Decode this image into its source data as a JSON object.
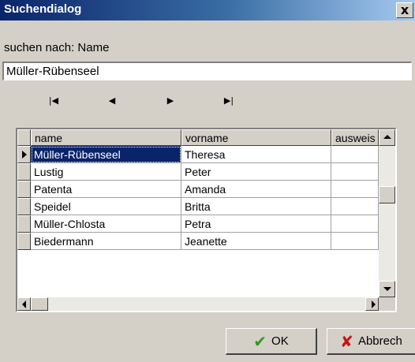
{
  "window": {
    "title": "Suchendialog",
    "close_label": "x"
  },
  "search": {
    "label": "suchen nach: Name",
    "value": "Müller-Rübenseel"
  },
  "navigator": {
    "first_glyph": "|◀",
    "prior_glyph": "◀",
    "next_glyph": "▶",
    "last_glyph": "▶|"
  },
  "grid": {
    "columns": [
      "name",
      "vorname",
      "ausweis"
    ],
    "rows": [
      {
        "name": "Müller-Rübenseel",
        "vorname": "Theresa",
        "ausweis": ""
      },
      {
        "name": "Lustig",
        "vorname": "Peter",
        "ausweis": ""
      },
      {
        "name": "Patenta",
        "vorname": "Amanda",
        "ausweis": ""
      },
      {
        "name": "Speidel",
        "vorname": "Britta",
        "ausweis": ""
      },
      {
        "name": "Müller-Chlosta",
        "vorname": "Petra",
        "ausweis": ""
      },
      {
        "name": "Biedermann",
        "vorname": "Jeanette",
        "ausweis": ""
      }
    ],
    "selected_row": 0
  },
  "buttons": {
    "ok_label": "OK",
    "ok_icon": "✔",
    "ok_icon_color": "#2e9a1e",
    "cancel_label": "Abbrech",
    "cancel_icon": "✘",
    "cancel_icon_color": "#c81414"
  },
  "colors": {
    "titlebar": "#0a246a",
    "selection": "#0a246a",
    "face": "#d4d0c8"
  }
}
